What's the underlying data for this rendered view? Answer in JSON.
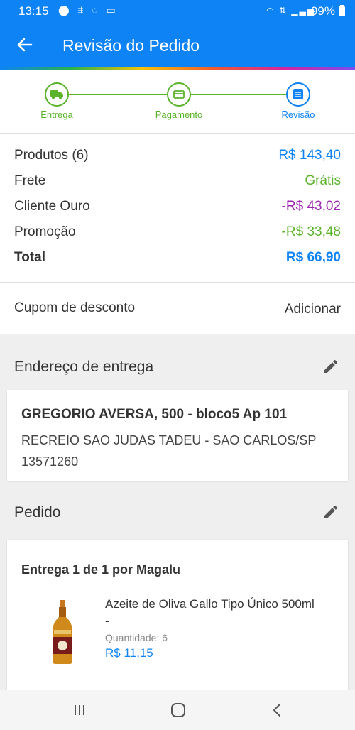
{
  "status_bar": {
    "time": "13:15",
    "battery": "99%"
  },
  "app_bar": {
    "title": "Revisão do Pedido"
  },
  "stepper": {
    "steps": [
      {
        "label": "Entrega",
        "icon": "truck-icon"
      },
      {
        "label": "Pagamento",
        "icon": "card-icon"
      },
      {
        "label": "Revisão",
        "icon": "list-icon"
      }
    ]
  },
  "summary": {
    "products_label": "Produtos (6)",
    "products_value": "R$ 143,40",
    "shipping_label": "Frete",
    "shipping_value": "Grátis",
    "gold_label": "Cliente Ouro",
    "gold_value": "-R$ 43,02",
    "promo_label": "Promoção",
    "promo_value": "-R$ 33,48",
    "total_label": "Total",
    "total_value": "R$ 66,90"
  },
  "coupon": {
    "label": "Cupom de desconto",
    "action": "Adicionar"
  },
  "address": {
    "section_title": "Endereço de entrega",
    "line1": "GREGORIO AVERSA, 500 - bloco5 Ap 101",
    "line2": "RECREIO SAO JUDAS TADEU - SAO CARLOS/SP",
    "line3": "13571260"
  },
  "order": {
    "section_title": "Pedido",
    "shipment_title": "Entrega 1 de 1 por Magalu",
    "product": {
      "name": "Azeite de Oliva Gallo Tipo Único 500ml",
      "name_suffix": "-",
      "quantity": "Quantidade:  6",
      "price": "R$ 11,15"
    }
  },
  "colors": {
    "primary": "#0d83f5",
    "green": "#5bb32a",
    "purple": "#9c27b0",
    "grey_bg": "#efefef"
  }
}
